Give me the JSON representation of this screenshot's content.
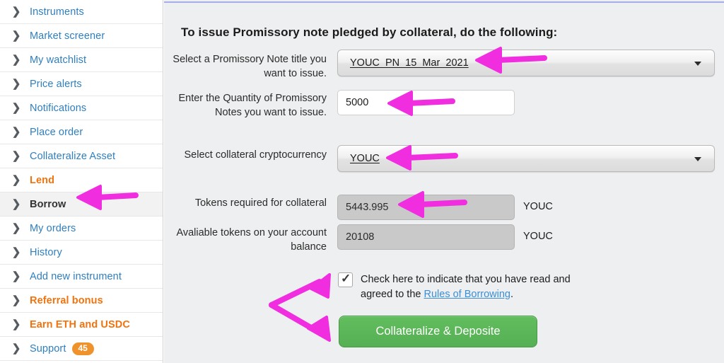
{
  "sidebar": {
    "items": [
      {
        "label": "Instruments",
        "style": "link",
        "icon": "chevron-right-icon"
      },
      {
        "label": "Market screener",
        "style": "link",
        "icon": "chevron-right-icon"
      },
      {
        "label": "My watchlist",
        "style": "link",
        "icon": "chevron-right-icon"
      },
      {
        "label": "Price alerts",
        "style": "link",
        "icon": "chevron-right-icon"
      },
      {
        "label": "Notifications",
        "style": "link",
        "icon": "chevron-right-icon"
      },
      {
        "label": "Place order",
        "style": "link",
        "icon": "chevron-right-icon"
      },
      {
        "label": "Collateralize Asset",
        "style": "link",
        "icon": "chevron-right-icon"
      },
      {
        "label": "Lend",
        "style": "accent",
        "icon": "chevron-right-icon"
      },
      {
        "label": "Borrow",
        "style": "active",
        "icon": "chevron-right-icon"
      },
      {
        "label": "My orders",
        "style": "link",
        "icon": "chevron-right-icon"
      },
      {
        "label": "History",
        "style": "link",
        "icon": "chevron-right-icon"
      },
      {
        "label": "Add new instrument",
        "style": "link",
        "icon": "chevron-right-icon"
      },
      {
        "label": "Referral bonus",
        "style": "accent",
        "icon": "chevron-right-icon"
      },
      {
        "label": "Earn ETH and USDC",
        "style": "accent",
        "icon": "chevron-right-icon"
      },
      {
        "label": "Support",
        "style": "link",
        "icon": "chevron-right-icon",
        "badge": "45"
      }
    ],
    "chevron_glyph": "❯",
    "link_color": "#2d7fc1",
    "accent_color": "#f2730d",
    "badge_color": "#f0922b"
  },
  "main": {
    "heading": "To issue Promissory note pledged by collateral, do the following:",
    "fields": {
      "note_title": {
        "label": "Select a Promissory Note title you want to issue.",
        "value": "YOUC_PN_15_Mar_2021",
        "caret_icon": "chevron-down-icon"
      },
      "quantity": {
        "label": "Enter the Quantity of Promissory Notes you want to issue.",
        "value": "5000"
      },
      "collateral_currency": {
        "label": "Select collateral cryptocurrency",
        "value": "YOUC",
        "caret_icon": "chevron-down-icon"
      },
      "tokens_required": {
        "label": "Tokens required for collateral",
        "value": "5443.995",
        "unit": "YOUC"
      },
      "available_tokens": {
        "label": "Avaliable tokens on your account balance",
        "value": "20108",
        "unit": "YOUC"
      }
    },
    "terms": {
      "checked": true,
      "check_icon": "checkmark-icon",
      "text_before": "Check here to indicate that you have read and agreed to the ",
      "link_text": "Rules of Borrowing",
      "text_after": "."
    },
    "submit_button": {
      "label": "Collateralize & Deposite",
      "color": "#57b254"
    },
    "accent_line_color": "#a7adea",
    "background_color": "#eeeff1"
  },
  "annotations": {
    "color": "#f02ee0",
    "arrows": [
      {
        "name": "arrow-to-borrow",
        "points_to": "Borrow"
      },
      {
        "name": "arrow-to-note-title",
        "points_to": "YOUC_PN_15_Mar_2021"
      },
      {
        "name": "arrow-to-quantity",
        "points_to": "5000"
      },
      {
        "name": "arrow-to-collateral",
        "points_to": "YOUC"
      },
      {
        "name": "arrow-to-tokens-required",
        "points_to": "5443.995"
      },
      {
        "name": "arrow-forked-to-checkbox-and-button",
        "points_to": "checkbox and Collateralize & Deposite"
      }
    ]
  }
}
